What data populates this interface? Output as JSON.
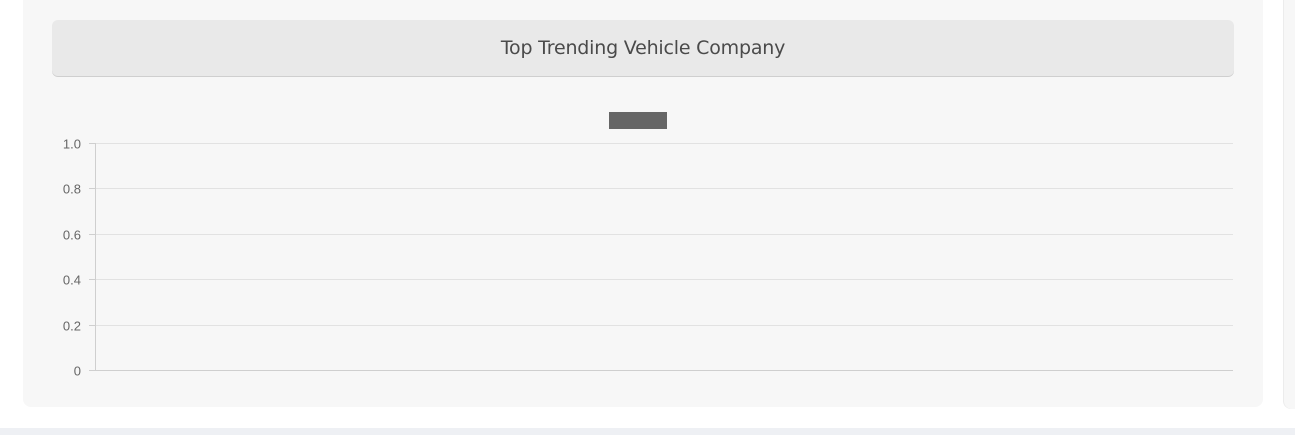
{
  "card": {
    "title": "Top Trending Vehicle Company"
  },
  "chart_data": {
    "type": "bar",
    "title": "",
    "categories": [],
    "series": [
      {
        "values": [],
        "color": "#666666"
      }
    ],
    "xlabel": "",
    "ylabel": "",
    "ylim": [
      0,
      1
    ],
    "yticks": [
      "0",
      "0.2",
      "0.4",
      "0.6",
      "0.8",
      "1.0"
    ],
    "grid": true,
    "legend": "top-center"
  },
  "colors": {
    "card_bg": "#f7f7f7",
    "header_bg": "#e9e9e9",
    "grid": "#e2e2e2",
    "axis": "#cfcfcf",
    "legend_swatch": "#666666"
  }
}
